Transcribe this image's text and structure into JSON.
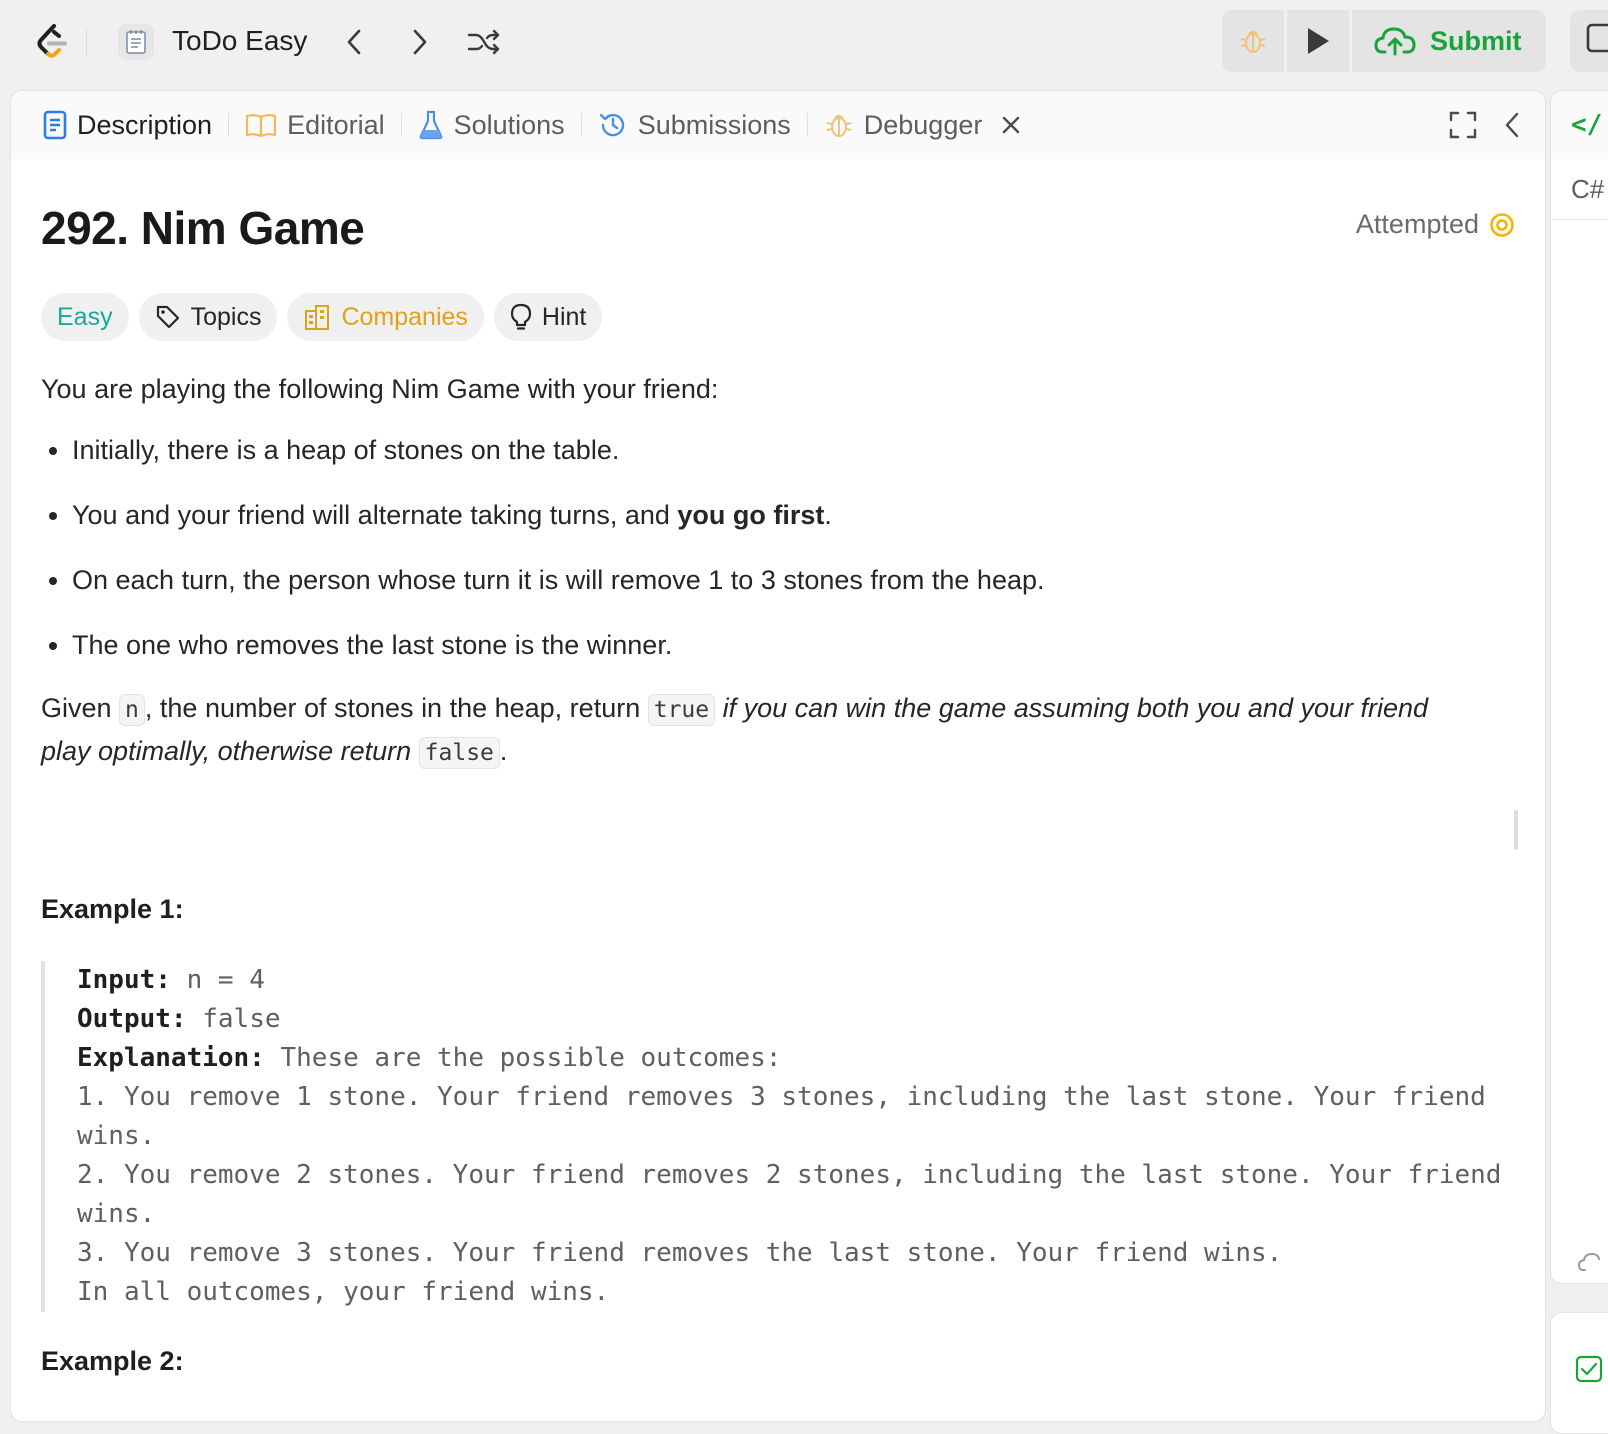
{
  "topbar": {
    "list_title": "ToDo Easy",
    "submit_label": "Submit"
  },
  "tabs": [
    {
      "label": "Description"
    },
    {
      "label": "Editorial"
    },
    {
      "label": "Solutions"
    },
    {
      "label": "Submissions"
    },
    {
      "label": "Debugger"
    }
  ],
  "problem": {
    "title": "292. Nim Game",
    "status": "Attempted",
    "chips": {
      "difficulty": "Easy",
      "topics": "Topics",
      "companies": "Companies",
      "hint": "Hint"
    },
    "intro": "You are playing the following Nim Game with your friend:",
    "rules": [
      "Initially, there is a heap of stones on the table.",
      "You and your friend will alternate taking turns, and ",
      "On each turn, the person whose turn it is will remove 1 to 3 stones from the heap.",
      "The one who removes the last stone is the winner."
    ],
    "rule2_bold": "you go first",
    "rule2_end": ".",
    "given": {
      "t1": "Given ",
      "c1": "n",
      "t2": ", the number of stones in the heap, return ",
      "c2": "true",
      "t3": " if you can win the game assuming both you and your friend play optimally, otherwise return ",
      "c3": "false",
      "t4": "."
    },
    "example1": {
      "title": "Example 1:",
      "input_label": "Input:",
      "input_value": " n = 4",
      "output_label": "Output:",
      "output_value": " false",
      "explanation_label": "Explanation:",
      "explanation_value": " These are the possible outcomes:",
      "lines": [
        "1. You remove 1 stone. Your friend removes 3 stones, including the last stone. Your friend wins.",
        "2. You remove 2 stones. Your friend removes 2 stones, including the last stone. Your friend wins.",
        "3. You remove 3 stones. Your friend removes the last stone. Your friend wins.",
        "In all outcomes, your friend wins."
      ]
    },
    "example2_title": "Example 2:"
  },
  "right_panel": {
    "code_icon_text": "</",
    "lang": "C#"
  },
  "colors": {
    "accent_green": "#1aa33b",
    "easy": "#18a8a0",
    "companies": "#e1a11a",
    "attempted_icon": "#f5b400"
  }
}
